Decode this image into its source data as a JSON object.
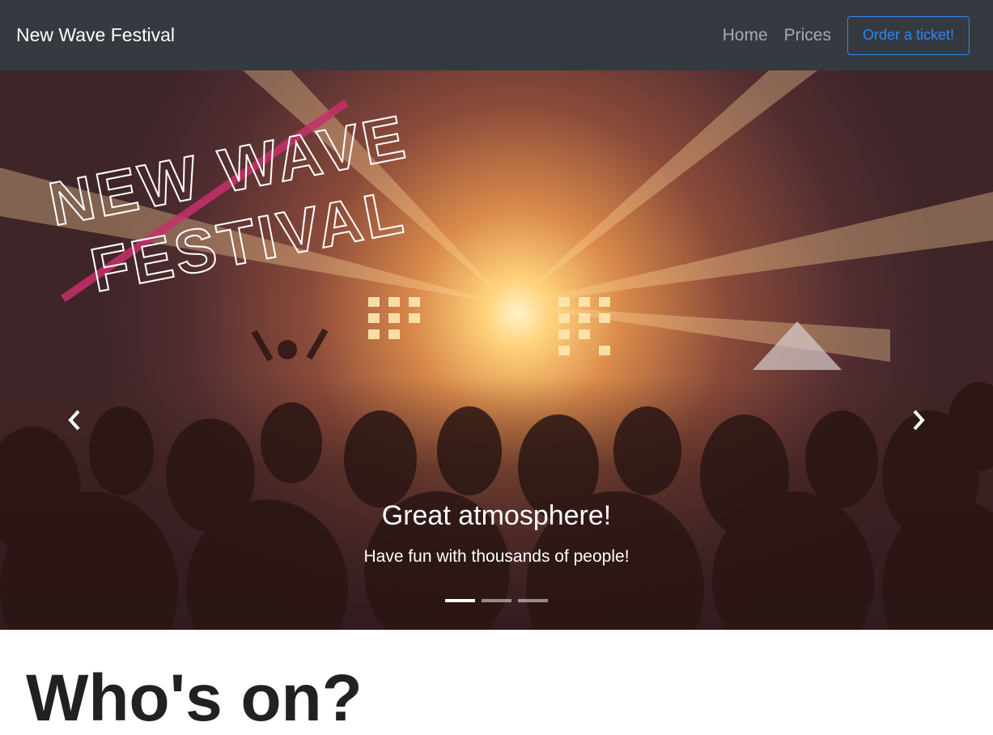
{
  "navbar": {
    "brand": "New Wave Festival",
    "links": [
      "Home",
      "Prices"
    ],
    "order_button": "Order a ticket!",
    "colors": {
      "background": "#343a40",
      "link": "#a6a9ad",
      "accent": "#2f86f6"
    }
  },
  "carousel": {
    "logo_text": [
      "NEW WAVE",
      "FESTIVAL"
    ],
    "caption_title": "Great atmosphere!",
    "caption_text": "Have fun with thousands of people!",
    "active_slide": 1,
    "slide_count": 3,
    "prev_icon": "chevron-left-icon",
    "next_icon": "chevron-right-icon"
  },
  "section": {
    "heading": "Who's on?"
  }
}
